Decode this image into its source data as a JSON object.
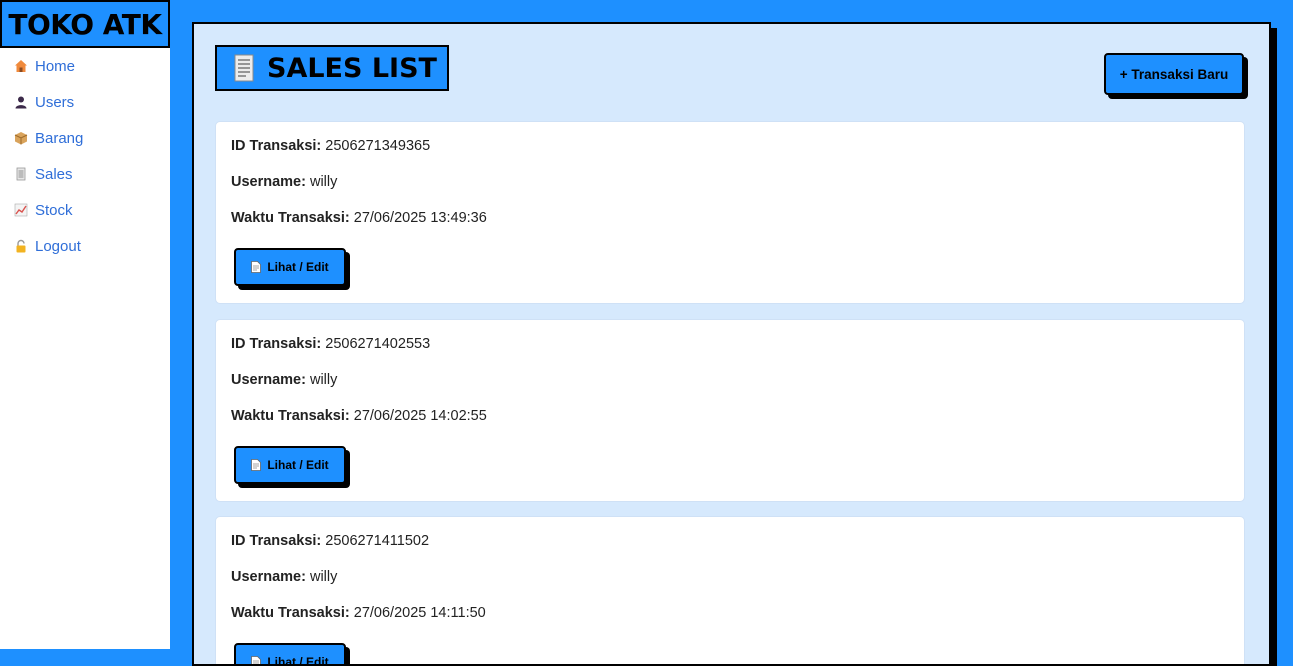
{
  "sidebar": {
    "brand": "TOKO ATK",
    "items": [
      {
        "label": "Home",
        "icon": "house-icon"
      },
      {
        "label": "Users",
        "icon": "user-icon"
      },
      {
        "label": "Barang",
        "icon": "package-icon"
      },
      {
        "label": "Sales",
        "icon": "receipt-icon"
      },
      {
        "label": "Stock",
        "icon": "chart-icon"
      },
      {
        "label": "Logout",
        "icon": "lock-icon"
      }
    ]
  },
  "main": {
    "title": "SALES LIST",
    "new_button": "+ Transaksi Baru",
    "field_labels": {
      "id": "ID Transaksi:",
      "username": "Username:",
      "time": "Waktu Transaksi:"
    },
    "edit_label": "Lihat / Edit",
    "transactions": [
      {
        "id": "2506271349365",
        "username": "willy",
        "time": "27/06/2025 13:49:36"
      },
      {
        "id": "2506271402553",
        "username": "willy",
        "time": "27/06/2025 14:02:55"
      },
      {
        "id": "2506271411502",
        "username": "willy",
        "time": "27/06/2025 14:11:50"
      }
    ]
  },
  "colors": {
    "accent": "#1e90ff",
    "panel": "#d6e9fd",
    "link": "#2f6ed8"
  }
}
